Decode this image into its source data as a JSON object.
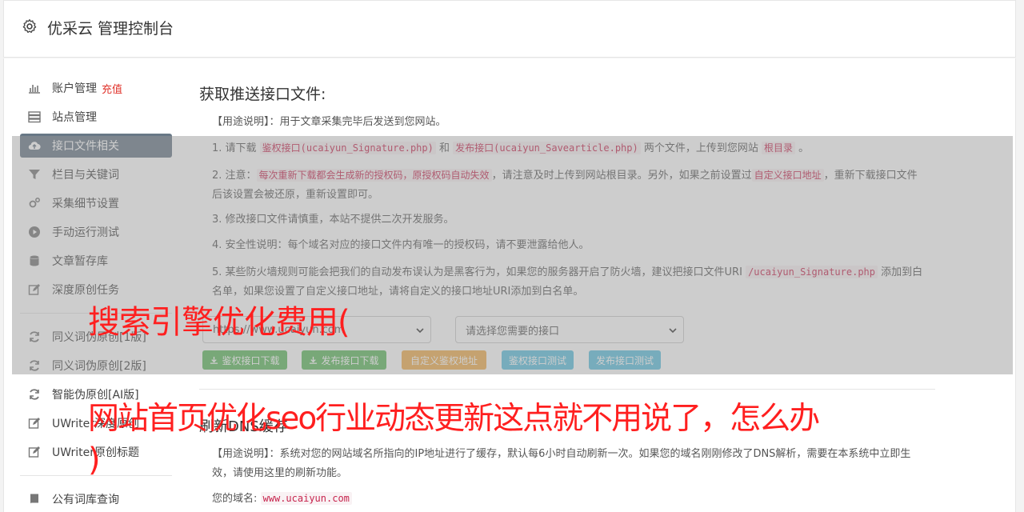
{
  "header": {
    "icon": "gear-icon",
    "title": "优采云 管理控制台"
  },
  "sidebar": {
    "items": [
      {
        "label": "账户管理",
        "badge": "充值",
        "icon": "bar-chart-icon"
      },
      {
        "label": "站点管理",
        "icon": "server-icon"
      },
      {
        "label": "接口文件相关",
        "icon": "cloud-upload-icon",
        "active": true
      },
      {
        "label": "栏目与关键词",
        "icon": "filter-icon"
      },
      {
        "label": "采集细节设置",
        "icon": "gears-icon"
      },
      {
        "label": "手动运行测试",
        "icon": "play-circle-icon"
      },
      {
        "label": "文章暂存库",
        "icon": "database-icon"
      },
      {
        "label": "深度原创任务",
        "icon": "edit-icon"
      }
    ],
    "items2": [
      {
        "label": "同义词伪原创[1版]",
        "icon": "refresh-icon"
      },
      {
        "label": "同义词伪原创[2版]",
        "icon": "refresh-icon"
      },
      {
        "label": "智能伪原创[AI版]",
        "icon": "refresh-icon"
      },
      {
        "label": "UWriter深度原创",
        "icon": "edit-icon"
      },
      {
        "label": "UWriter原创标题",
        "icon": "edit-icon"
      }
    ],
    "items3": [
      {
        "label": "公有词库查询",
        "icon": "book-icon"
      }
    ]
  },
  "main": {
    "section1_title": "获取推送接口文件:",
    "usage": "【用途说明】：用于文章采集完毕后发送到您网站。",
    "step1": {
      "a": "1. 请下载 ",
      "code1": "鉴权接口(ucaiyun_Signature.php)",
      "b": " 和 ",
      "code2": "发布接口(ucaiyun_Savearticle.php)",
      "c": " 两个文件，上传到您网站 ",
      "code3": "根目录",
      "d": " 。"
    },
    "step2": {
      "a": "2. 注意：",
      "code1": "每次重新下载都会生成新的授权码，原授权码自动失效",
      "b": "，请注意及时上传到网站根目录。另外，如果之前设置过",
      "code2": "自定义接口地址",
      "c": "，重新下载接口文件后该设置会被还原，重新设置即可。"
    },
    "step3": "3. 修改接口文件请慎重，本站不提供二次开发服务。",
    "step4": "4. 安全性说明：每个域名对应的接口文件内有唯一的授权码，请不要泄露给他人。",
    "step5": {
      "a": "5. 某些防火墙规则可能会把我们的自动发布误认为是黑客行为，如果您的服务器开启了防火墙，建议把接口文件URI ",
      "code1": "/ucaiyun_Signature.php",
      "b": " 添加到白名单，如果您设置了自定义接口地址，请将自定义的接口地址URI添加到白名单。"
    },
    "select_site": "https://www.ucaiyun.com",
    "select_api": "请选择您需要的接口",
    "buttons": {
      "download_sign": "鉴权接口下载",
      "download_publish": "发布接口下载",
      "custom_sign": "自定义鉴权地址",
      "test_sign": "鉴权接口测试",
      "test_publish": "发布接口测试"
    },
    "section2_title": "刷新DNS缓存",
    "dns_usage": "【用途说明】：系统对您的网站域名所指向的IP地址进行了缓存，默认每6小时自动刷新一次。如果您的域名刚刚修改了DNS解析，需要在本系统中立即生效，请使用这里的刷新功能。",
    "domain_label": "您的域名:",
    "domain_value": "www.ucaiyun.com"
  },
  "overlay_text": {
    "line1": "搜索引擎优化费用(",
    "line2": "网站首页优化seo行业动态更新这点就不用说了，怎么办",
    "line3": ")"
  },
  "colors": {
    "active_nav": "#687886",
    "red_overlay_text": "#ff1f1f",
    "code_red": "#c7254e"
  }
}
